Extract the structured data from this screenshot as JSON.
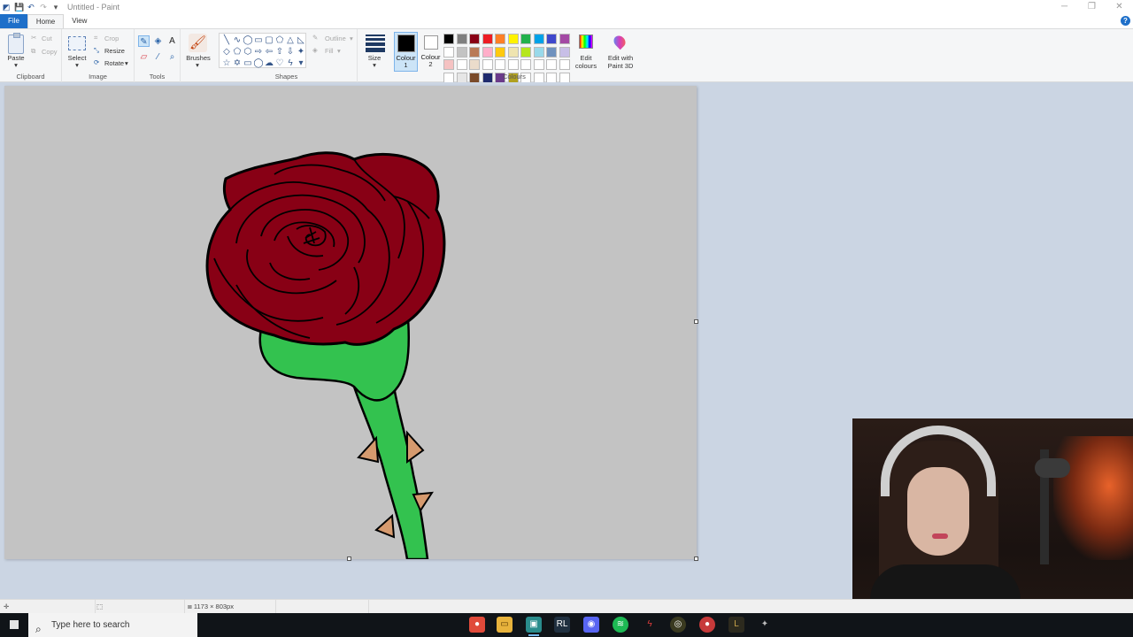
{
  "window": {
    "title": "Untitled - Paint",
    "minimize": "─",
    "restore": "❐",
    "close": "✕"
  },
  "menu": {
    "file": "File",
    "home": "Home",
    "view": "View",
    "help": "?"
  },
  "ribbon": {
    "clipboard": {
      "label": "Clipboard",
      "paste": "Paste",
      "cut": "Cut",
      "copy": "Copy"
    },
    "image": {
      "label": "Image",
      "select": "Select",
      "crop": "Crop",
      "resize": "Resize",
      "rotate": "Rotate"
    },
    "tools": {
      "label": "Tools"
    },
    "brushes": {
      "label": "Brushes"
    },
    "shapes": {
      "label": "Shapes",
      "outline": "Outline",
      "fill": "Fill"
    },
    "size": {
      "label": "Size"
    },
    "colours": {
      "label": "Colours",
      "colour1": "Colour\n1",
      "colour2": "Colour\n2",
      "colour1_value": "#000000",
      "colour2_value": "#ffffff",
      "palette": [
        "#000000",
        "#7f7f7f",
        "#880015",
        "#ed1c24",
        "#ff7f27",
        "#fff200",
        "#22b14c",
        "#00a2e8",
        "#3f48cc",
        "#a349a4",
        "#ffffff",
        "#c3c3c3",
        "#b97a57",
        "#ffaec9",
        "#ffc90e",
        "#efe4b0",
        "#b5e61d",
        "#99d9ea",
        "#7092be",
        "#c8bfe7",
        "#f5c2c2",
        "#ffffff",
        "#ebdccb",
        "#ffffff",
        "#ffffff",
        "#ffffff",
        "#ffffff",
        "#ffffff",
        "#ffffff",
        "#ffffff",
        "#ffffff",
        "#e6e6e6",
        "#7a4a2a",
        "#1e2a6e",
        "#6b3a8a",
        "#b0a020",
        "#ffffff",
        "#ffffff",
        "#ffffff",
        "#ffffff"
      ],
      "edit_colours": "Edit\ncolours",
      "edit_paint3d": "Edit with\nPaint 3D"
    }
  },
  "canvas": {
    "colors": {
      "background": "#c3c3c3",
      "petals": "#880015",
      "stem": "#33c24f",
      "thorns": "#d69a6e",
      "outline": "#000000"
    }
  },
  "status": {
    "canvas_size": "1173 × 803px"
  },
  "taskbar": {
    "search_placeholder": "Type here to search",
    "apps": [
      "chrome-icon",
      "file-explorer-icon",
      "paint-app-icon",
      "rl-app-icon",
      "discord-icon",
      "spotify-icon",
      "streaming-app-icon",
      "game-app-icon",
      "chrome-dev-icon",
      "league-icon",
      "tool-app-icon"
    ]
  }
}
